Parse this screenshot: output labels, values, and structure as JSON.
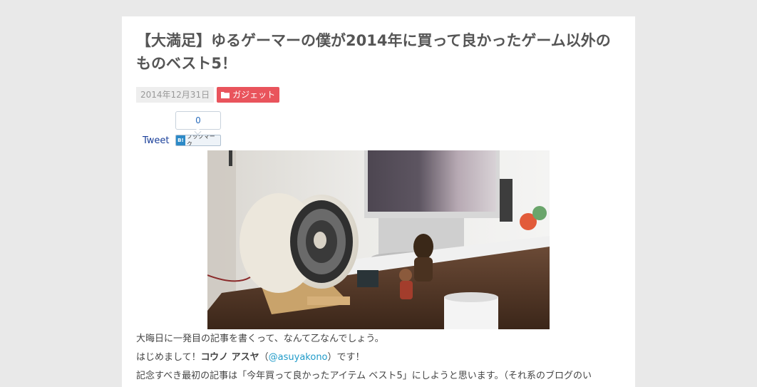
{
  "post": {
    "title": "【大満足】ゆるゲーマーの僕が2014年に買って良かったゲーム以外のものベスト5！",
    "date": "2014年12月31日",
    "category": "ガジェット",
    "icons": {
      "category": "folder-icon"
    }
  },
  "share": {
    "tweet_label": "Tweet",
    "hatena_count": "0",
    "hatena_label": "ブックマーク",
    "hatena_badge": "B!"
  },
  "content": {
    "line1": "大晦日に一発目の記事を書くって、なんて乙なんでしょう。",
    "line2_pre": "はじめまして！",
    "author_name": "コウノ アスヤ",
    "line2_paren_open": "（",
    "twitter_handle": "@asuyakono",
    "line2_post": "）です！",
    "line3": "記念すべき最初の記事は「今年買って良かったアイテム ベスト5」にしようと思います。（それ系のブログのい"
  }
}
